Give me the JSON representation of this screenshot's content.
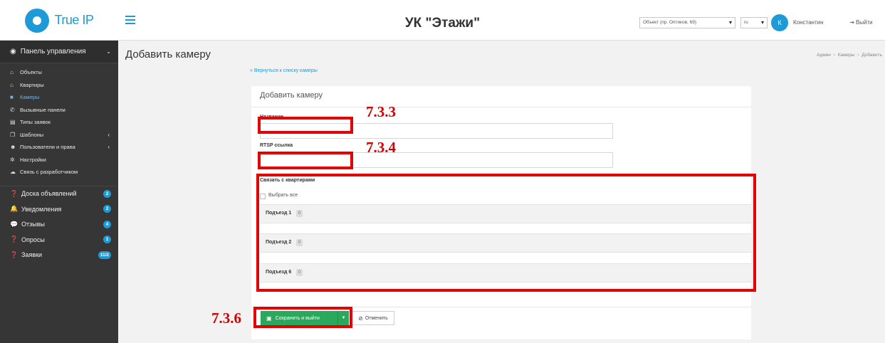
{
  "topbar": {
    "logo_text": "True IP",
    "title": "УК \"Этажи\"",
    "object_select": "Объект (пр. Оптиков, 69)",
    "lang_select": "ru",
    "avatar_letter": "К",
    "user_name": "Константин",
    "logout_label": "Выйти"
  },
  "sidebar": {
    "header": "Панель управления",
    "sub_items": [
      {
        "label": "Объекты",
        "icon": "home-icon"
      },
      {
        "label": "Квартиры",
        "icon": "home-icon"
      },
      {
        "label": "Камеры",
        "icon": "video-camera-icon"
      },
      {
        "label": "Вызывные панели",
        "icon": "phone-icon"
      },
      {
        "label": "Типы заявок",
        "icon": "list-icon"
      },
      {
        "label": "Шаблоны",
        "icon": "copy-icon"
      },
      {
        "label": "Пользователи и права",
        "icon": "users-icon"
      },
      {
        "label": "Настройки",
        "icon": "gear-icon"
      },
      {
        "label": "Связь с разработчиком",
        "icon": "comments-icon"
      }
    ],
    "main_items": [
      {
        "label": "Доска объявлений",
        "badge": "2"
      },
      {
        "label": "Уведомления",
        "badge": "2"
      },
      {
        "label": "Отзывы",
        "badge": "4"
      },
      {
        "label": "Опросы",
        "badge": "1"
      },
      {
        "label": "Заявки",
        "badge": "11/2"
      }
    ]
  },
  "content": {
    "heading": "Добавить камеру",
    "breadcrumb": [
      "Админ",
      "Камеры",
      "Добавить"
    ],
    "back_link": "« Вернуться к списку камеры",
    "card_title": "Добавить камеру",
    "name_label": "Название",
    "name_value": "",
    "rtsp_label": "RTSP ссылка",
    "rtsp_value": "",
    "link_label": "Связать с квартирами",
    "select_all": "Выбрать все",
    "groups": [
      {
        "name": "Подъезд 1",
        "count": "0"
      },
      {
        "name": "Подъезд 2",
        "count": "0"
      },
      {
        "name": "Подъезд 6",
        "count": "0"
      }
    ],
    "save_button": "Сохранить и выйти",
    "cancel_button": "Отменить"
  },
  "annotations": {
    "a1": "7.3.3",
    "a2": "7.3.4",
    "a3": "7.3.6"
  },
  "colors": {
    "accent": "#1e9bd7",
    "sidebar_bg": "#363636",
    "save_green": "#2aa85b",
    "annotation_red": "#e20000"
  }
}
